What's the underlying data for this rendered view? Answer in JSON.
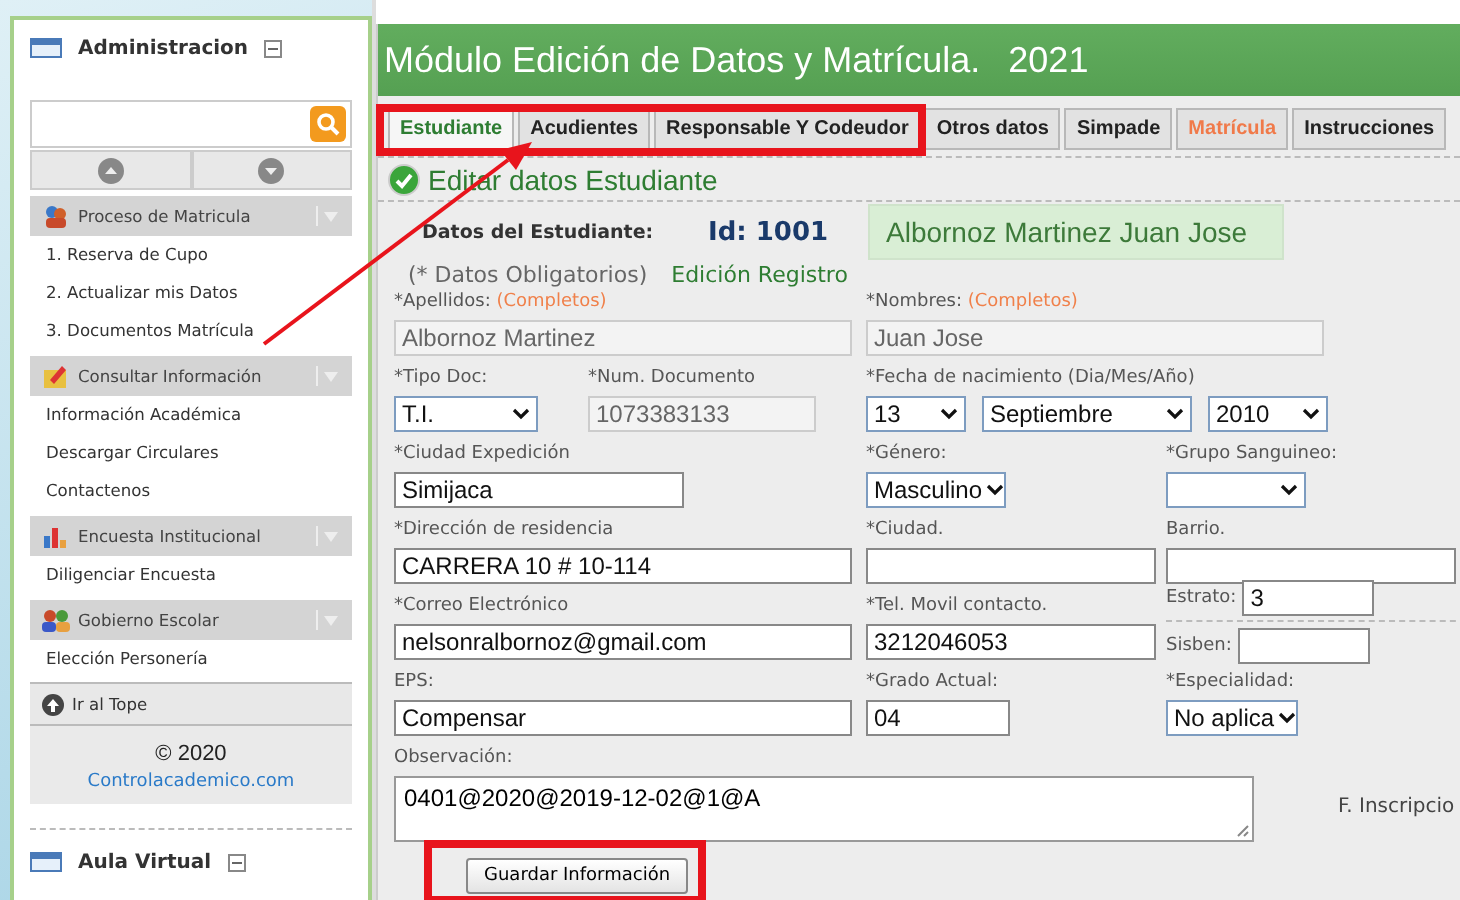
{
  "sidebar": {
    "title": "Administracion",
    "groups": [
      {
        "kind": "enrolment",
        "title": "Proceso de Matricula",
        "items": [
          "1. Reserva de Cupo",
          "2. Actualizar mis Datos",
          "3. Documentos Matrícula"
        ]
      },
      {
        "kind": "info",
        "title": "Consultar Información",
        "items": [
          "Información Académica",
          "Descargar Circulares",
          "Contactenos"
        ]
      },
      {
        "kind": "survey",
        "title": "Encuesta Institucional",
        "items": [
          "Diligenciar Encuesta"
        ]
      },
      {
        "kind": "government",
        "title": "Gobierno Escolar",
        "items": [
          "Elección Personería"
        ]
      }
    ],
    "top_link": "Ir al Tope",
    "copyright": "© 2020",
    "site_link": "Controlacademico.com",
    "section": "Aula Virtual"
  },
  "header": {
    "title": "Módulo Edición de Datos y Matrícula.",
    "year": "2021"
  },
  "tabs": [
    {
      "label": "Estudiante",
      "selected": true,
      "highlighted": false
    },
    {
      "label": "Acudientes",
      "selected": false,
      "highlighted": false
    },
    {
      "label": "Responsable Y Codeudor",
      "selected": false,
      "highlighted": false
    },
    {
      "label": "Otros datos",
      "selected": false,
      "highlighted": false
    },
    {
      "label": "Simpade",
      "selected": false,
      "highlighted": false
    },
    {
      "label": "Matrícula",
      "selected": false,
      "highlighted": true
    },
    {
      "label": "Instrucciones",
      "selected": false,
      "highlighted": false
    }
  ],
  "section_title": "Editar datos Estudiante",
  "student": {
    "label": "Datos del Estudiante:",
    "id": "Id: 1001",
    "name": "Albornoz Martinez Juan Jose",
    "required_note": "(* Datos Obligatorios)",
    "mode": "Edición Registro"
  },
  "form": {
    "rows": [
      [
        {
          "label": "*Apellidos:",
          "note": "(Completos)",
          "controls": [
            {
              "kind": "readonly",
              "value": "Albornoz Martinez"
            }
          ]
        },
        {
          "label": "*Nombres:",
          "note": "(Completos)",
          "controls": [
            {
              "kind": "readonly",
              "value": "Juan Jose"
            }
          ]
        }
      ],
      [
        {
          "label": "*Tipo Doc:",
          "controls": [
            {
              "kind": "select",
              "value": "T.I."
            }
          ]
        },
        {
          "label": "*Num. Documento",
          "controls": [
            {
              "kind": "readonly",
              "value": "1073383133"
            }
          ]
        },
        {
          "label": "*Fecha de nacimiento (Dia/Mes/Año)",
          "controls": [
            {
              "kind": "select",
              "value": "13"
            },
            {
              "kind": "select",
              "value": "Septiembre"
            },
            {
              "kind": "select",
              "value": "2010"
            }
          ]
        }
      ],
      [
        {
          "label": "*Ciudad Expedición",
          "controls": [
            {
              "kind": "text",
              "value": "Simijaca"
            }
          ]
        },
        {
          "label": "*Género:",
          "controls": [
            {
              "kind": "select",
              "value": "Masculino"
            }
          ]
        },
        {
          "label": "*Grupo Sanguineo:",
          "controls": [
            {
              "kind": "select"
            }
          ]
        }
      ],
      [
        {
          "label": "*Dirección de residencia",
          "controls": [
            {
              "kind": "text",
              "value": "CARRERA 10 # 10-114"
            }
          ]
        },
        {
          "label": "*Ciudad.",
          "controls": [
            {
              "kind": "text"
            }
          ]
        },
        {
          "label": "Barrio.",
          "controls": [
            {
              "kind": "text"
            }
          ]
        }
      ],
      [
        {
          "label": "*Correo Electrónico",
          "controls": [
            {
              "kind": "text",
              "value": "nelsonralbornoz@gmail.com"
            }
          ]
        },
        {
          "label": "*Tel. Movil contacto.",
          "controls": [
            {
              "kind": "text",
              "value": "3212046053"
            }
          ]
        },
        {
          "kind": "pairs",
          "pairs": [
            {
              "label": "Estrato:",
              "value": "3"
            },
            {
              "label": "Sisben:"
            }
          ]
        }
      ],
      [
        {
          "label": "EPS:",
          "controls": [
            {
              "kind": "text",
              "value": "Compensar"
            }
          ]
        },
        {
          "label": "*Grado Actual:",
          "controls": [
            {
              "kind": "text",
              "value": "04"
            }
          ]
        },
        {
          "label": "*Especialidad:",
          "controls": [
            {
              "kind": "select",
              "value": "No aplica"
            }
          ]
        }
      ]
    ],
    "observation": {
      "label": "Observación:",
      "value": "0401@2020@2019-12-02@1@A"
    },
    "registration_label": "F. Inscripcio",
    "save_button": "Guardar Información"
  },
  "annotations": [
    {
      "kind": "frame"
    },
    {
      "kind": "frame"
    },
    {
      "kind": "arrow"
    }
  ]
}
